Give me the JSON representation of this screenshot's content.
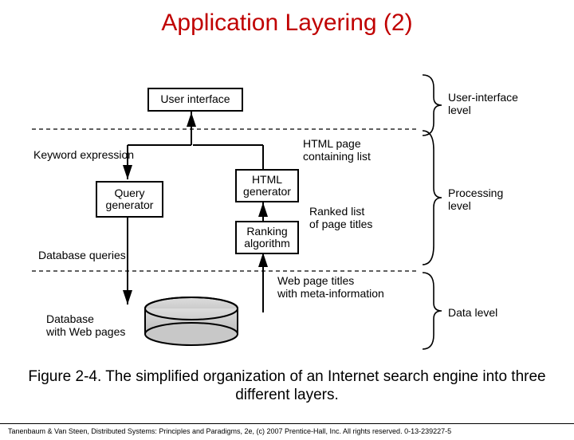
{
  "title": "Application Layering (2)",
  "caption": "Figure 2-4. The simplified organization of an Internet search engine into three different layers.",
  "footer": "Tanenbaum & Van Steen, Distributed Systems: Principles and Paradigms, 2e, (c) 2007 Prentice-Hall, Inc. All rights reserved. 0-13-239227-5",
  "boxes": {
    "ui": "User interface",
    "html_gen": "HTML\ngenerator",
    "query_gen": "Query\ngenerator",
    "ranking": "Ranking\nalgorithm"
  },
  "labels": {
    "ui_level": "User-interface\nlevel",
    "proc_level": "Processing\nlevel",
    "data_level": "Data level",
    "keyword": "Keyword expression",
    "html_page": "HTML page\ncontaining list",
    "ranked_list": "Ranked list\nof page titles",
    "db_queries": "Database queries",
    "web_titles": "Web page titles\nwith meta-information",
    "db_caption": "Database\nwith Web pages"
  }
}
